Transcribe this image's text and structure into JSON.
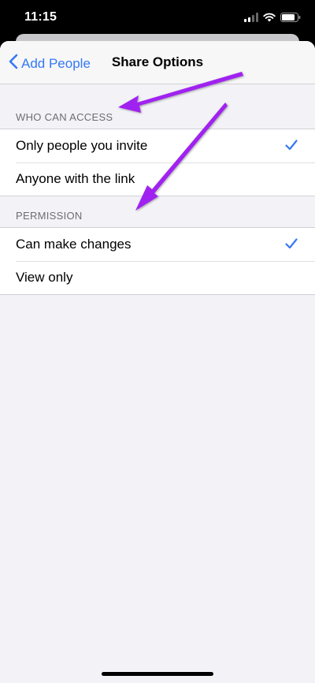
{
  "status_bar": {
    "time": "11:15",
    "icons": [
      "cellular-signal-icon",
      "wifi-icon",
      "battery-icon"
    ]
  },
  "nav": {
    "back_label": "Add People",
    "title": "Share Options"
  },
  "sections": [
    {
      "header": "WHO CAN ACCESS",
      "options": [
        {
          "label": "Only people you invite",
          "selected": true
        },
        {
          "label": "Anyone with the link",
          "selected": false
        }
      ]
    },
    {
      "header": "PERMISSION",
      "options": [
        {
          "label": "Can make changes",
          "selected": true
        },
        {
          "label": "View only",
          "selected": false
        }
      ]
    }
  ],
  "colors": {
    "accent": "#3478f6",
    "annotation_arrow": "#a020f0",
    "background": "#f2f2f7"
  }
}
